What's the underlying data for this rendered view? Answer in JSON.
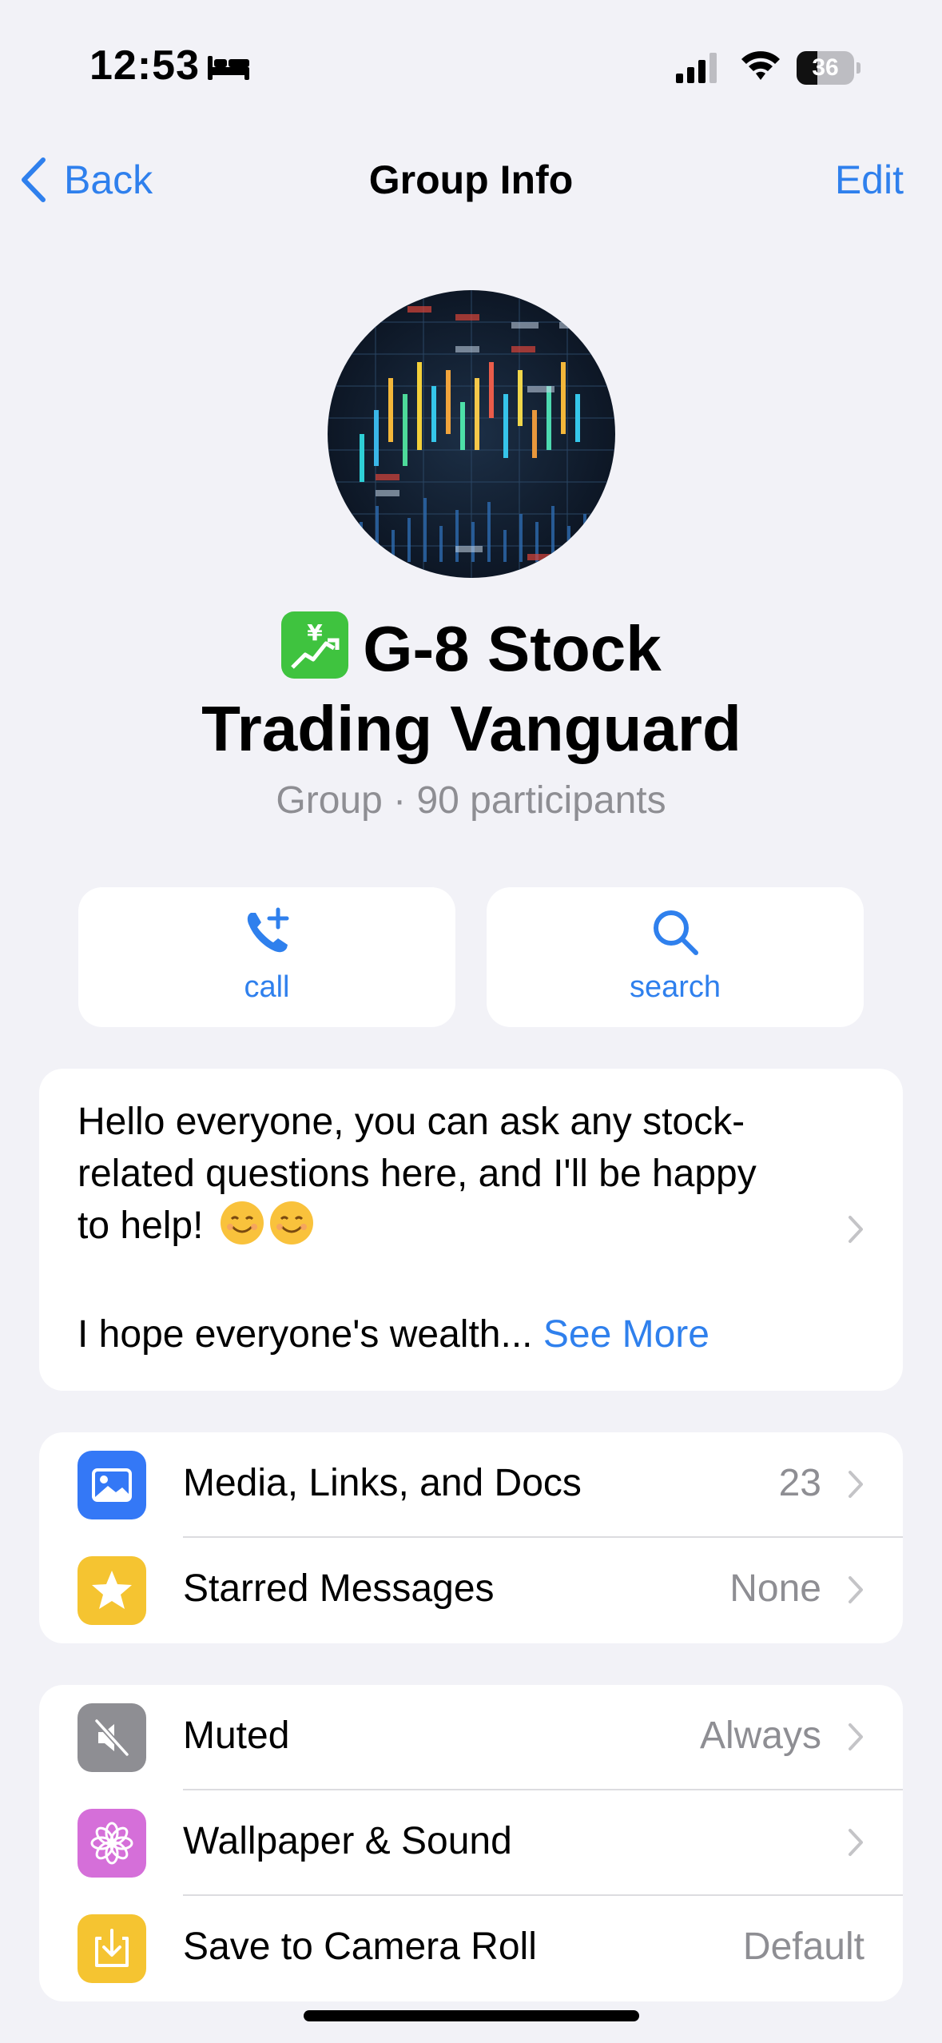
{
  "status_bar": {
    "time": "12:53",
    "battery": "36",
    "battery_level": 0.36,
    "icons": [
      "bed-icon",
      "signal-icon",
      "wifi-icon",
      "battery-icon"
    ]
  },
  "nav": {
    "back_label": "Back",
    "title": "Group Info",
    "edit_label": "Edit"
  },
  "group": {
    "emoji_icon": "chart-yen-icon",
    "name_line1": "G-8 Stock",
    "name_line2": "Trading Vanguard",
    "subtitle": "Group · 90 participants"
  },
  "actions": {
    "call_label": "call",
    "search_label": "search"
  },
  "description": {
    "line1": "Hello everyone, you can ask any stock-",
    "line2": "related questions here, and I'll be happy",
    "line3": "to help!",
    "line4": "I hope everyone's wealth...",
    "see_more": "See More",
    "emoji": [
      "smiling-face-icon",
      "smiling-face-icon"
    ]
  },
  "media_section": [
    {
      "label": "Media, Links, and Docs",
      "value": "23",
      "icon": "photo-icon",
      "color": "#3478f6"
    },
    {
      "label": "Starred Messages",
      "value": "None",
      "icon": "star-icon",
      "color": "#f5c431"
    }
  ],
  "settings_section": [
    {
      "label": "Muted",
      "value": "Always",
      "icon": "speaker-muted-icon",
      "color": "#8e8e93"
    },
    {
      "label": "Wallpaper & Sound",
      "value": "",
      "icon": "flower-icon",
      "color": "#d56fd9"
    },
    {
      "label": "Save to Camera Roll",
      "value": "Default",
      "icon": "download-icon",
      "color": "#f5c431"
    }
  ],
  "colors": {
    "accent": "#2f80ed",
    "background": "#f2f2f7"
  }
}
